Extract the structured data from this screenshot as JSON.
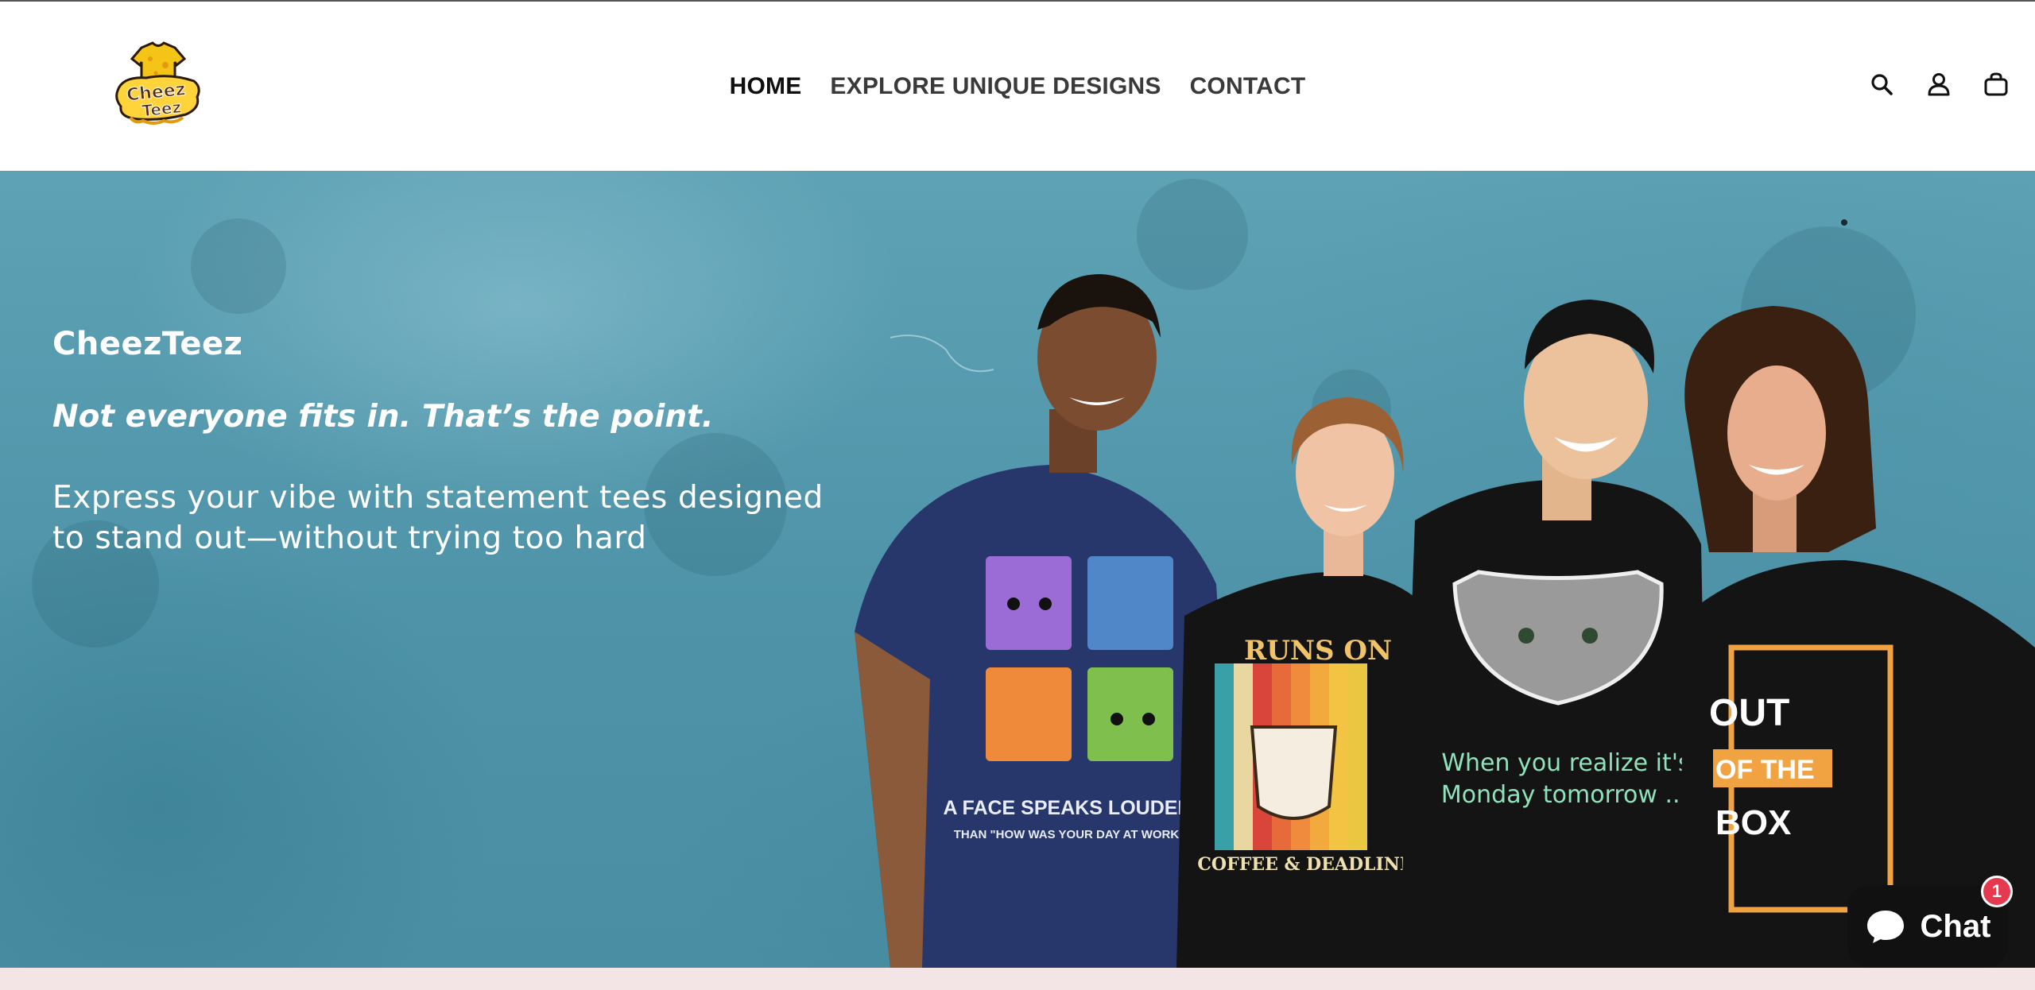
{
  "brand": {
    "logo_alt": "Cheez Teez",
    "logo_line1": "Cheez",
    "logo_line2": "Teez"
  },
  "nav": {
    "items": [
      {
        "label": "HOME",
        "active": true
      },
      {
        "label": "EXPLORE UNIQUE DESIGNS",
        "active": false
      },
      {
        "label": "CONTACT",
        "active": false
      }
    ]
  },
  "header_icons": [
    "search-icon",
    "account-icon",
    "cart-icon"
  ],
  "hero": {
    "brand": "CheezTeez",
    "tagline": "Not everyone fits in. That’s the point.",
    "description": "Express your vibe with statement tees designed to stand out—without trying too hard",
    "shirts": [
      {
        "line1": "A FACE SPEAKS LOUDER",
        "line2": "THAN \"HOW WAS YOUR DAY AT WORK\""
      },
      {
        "line1": "RUNS ON",
        "line2": "COFFEE & DEADLINES"
      },
      {
        "line1": "When you realize it's",
        "line2": "Monday tomorrow ..."
      },
      {
        "line1": "OUT",
        "line2": "OF THE",
        "line3": "BOX"
      }
    ]
  },
  "chat": {
    "label": "Chat",
    "badge": "1"
  },
  "colors": {
    "hero_bg": "#4e93a8",
    "nav_text": "#3a3a3a",
    "nav_active": "#0f0f0f",
    "chat_bg": "#111111",
    "badge": "#e4394f",
    "bottom_strip": "#f3e5e5"
  }
}
